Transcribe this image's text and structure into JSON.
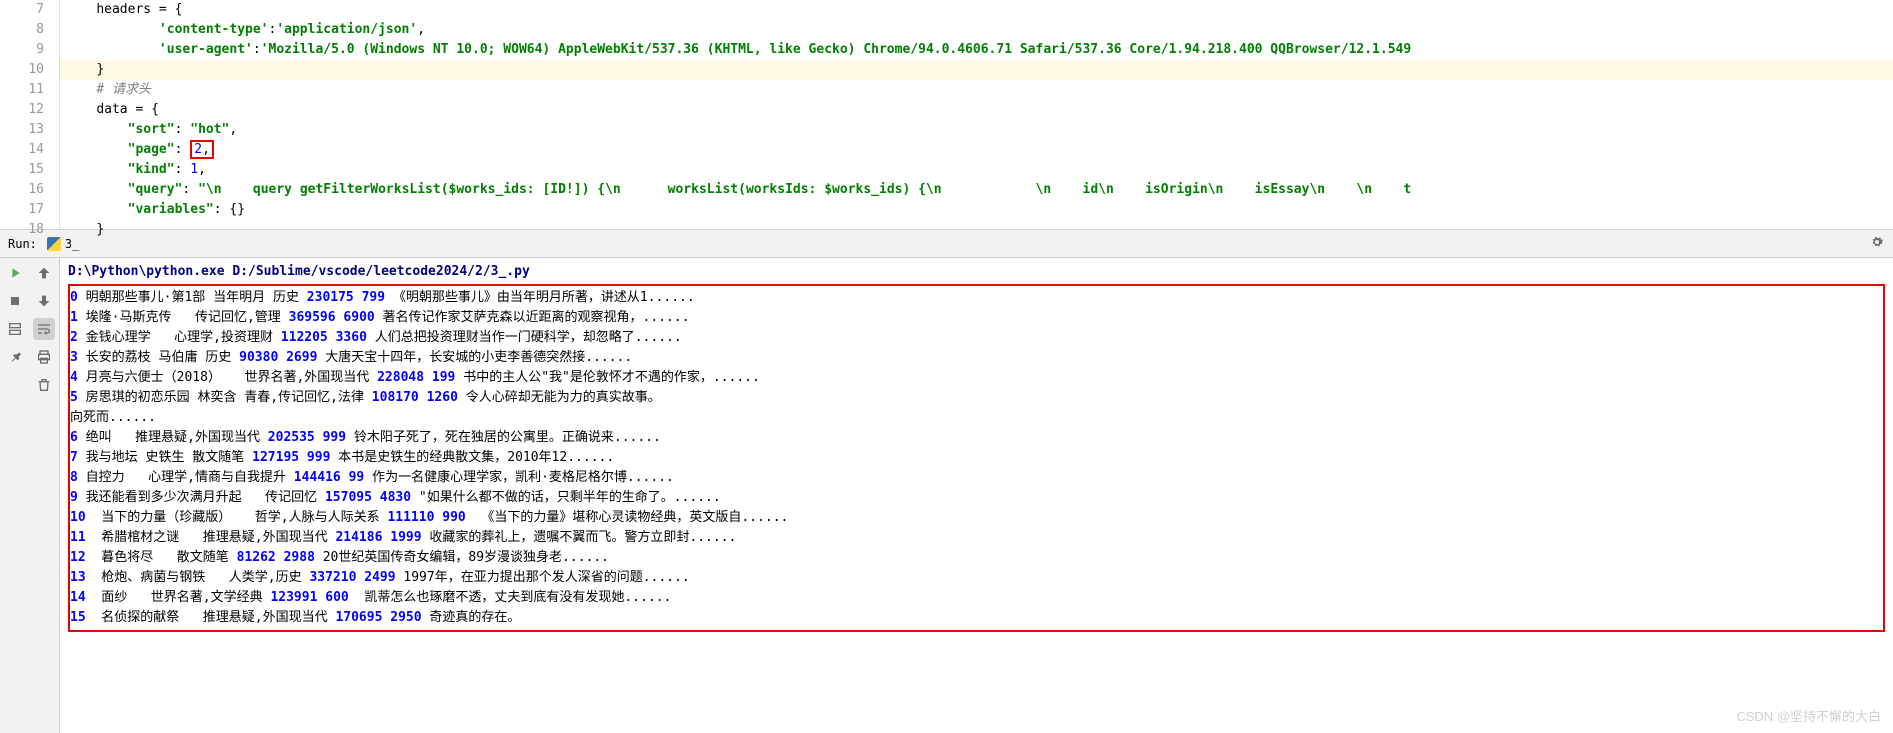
{
  "editor": {
    "lines": [
      7,
      8,
      9,
      10,
      11,
      12,
      13,
      14,
      15,
      16,
      17,
      18
    ],
    "l7_var": "headers",
    "l7_eq": " = ",
    "l7_brace": "{",
    "l8_key": "'content-type'",
    "l8_colon": ":",
    "l8_val": "'application/json'",
    "l8_comma": ",",
    "l9_key": "'user-agent'",
    "l9_colon": ":",
    "l9_val": "'Mozilla/5.0 (Windows NT 10.0; WOW64) AppleWebKit/537.36 (KHTML, like Gecko) Chrome/94.0.4606.71 Safari/537.36 Core/1.94.218.400 QQBrowser/12.1.549",
    "l10_brace": "}",
    "l11_comment": "# 请求头",
    "l12_var": "data",
    "l12_eq": " = {",
    "l13_key": "\"sort\"",
    "l13_colon": ": ",
    "l13_val": "\"hot\"",
    "l13_comma": ",",
    "l14_key": "\"page\"",
    "l14_colon": ": ",
    "l14_val": "2",
    "l14_comma": ",",
    "l15_key": "\"kind\"",
    "l15_colon": ": ",
    "l15_val": "1",
    "l15_comma": ",",
    "l16_key": "\"query\"",
    "l16_colon": ": ",
    "l16_val": "\"\\n    query getFilterWorksList($works_ids: [ID!]) {\\n      worksList(worksIds: $works_ids) {\\n            \\n    id\\n    isOrigin\\n    isEssay\\n    \\n    t",
    "l17_key": "\"variables\"",
    "l17_colon": ": {}",
    "l18_brace": "}"
  },
  "run": {
    "label": "Run:",
    "script": "3_"
  },
  "console": {
    "cmd_exe": "D:\\Python\\python.exe",
    "cmd_arg": " D:/Sublime/vscode/leetcode2024/2/3_.py",
    "rows": [
      {
        "idx": "0",
        "title": " 明朝那些事儿·第1部 当年明月 历史 ",
        "n1": "230175",
        "n2": " 799",
        "tail": " 《明朝那些事儿》由当年明月所著，讲述从1......"
      },
      {
        "idx": "1",
        "title": " 埃隆·马斯克传   传记回忆,管理 ",
        "n1": "369596",
        "n2": " 6900",
        "tail": " 著名传记作家艾萨克森以近距离的观察视角，......"
      },
      {
        "idx": "2",
        "title": " 金钱心理学   心理学,投资理财 ",
        "n1": "112205",
        "n2": " 3360",
        "tail": " 人们总把投资理财当作一门硬科学，却忽略了......"
      },
      {
        "idx": "3",
        "title": " 长安的荔枝 马伯庸 历史 ",
        "n1": "90380",
        "n2": " 2699",
        "tail": " 大唐天宝十四年，长安城的小吏李善德突然接......"
      },
      {
        "idx": "4",
        "title": " 月亮与六便士（2018）   世界名著,外国现当代 ",
        "n1": "228048",
        "n2": " 199",
        "tail": " 书中的主人公\"我\"是伦敦怀才不遇的作家，......"
      },
      {
        "idx": "5",
        "title": " 房思琪的初恋乐园 林奕含 青春,传记回忆,法律 ",
        "n1": "108170",
        "n2": " 1260",
        "tail": " 令人心碎却无能为力的真实故事。"
      },
      {
        "idx": "",
        "title": "向死而......",
        "n1": "",
        "n2": "",
        "tail": ""
      },
      {
        "idx": "6",
        "title": " 绝叫   推理悬疑,外国现当代 ",
        "n1": "202535",
        "n2": " 999",
        "tail": " 铃木阳子死了，死在独居的公寓里。正确说来......"
      },
      {
        "idx": "7",
        "title": " 我与地坛 史铁生 散文随笔 ",
        "n1": "127195",
        "n2": " 999",
        "tail": " 本书是史铁生的经典散文集，2010年12......"
      },
      {
        "idx": "8",
        "title": " 自控力   心理学,情商与自我提升 ",
        "n1": "144416",
        "n2": " 99",
        "tail": " 作为一名健康心理学家，凯利·麦格尼格尔博......"
      },
      {
        "idx": "9",
        "title": " 我还能看到多少次满月升起   传记回忆 ",
        "n1": "157095",
        "n2": " 4830",
        "tail": " \"如果什么都不做的话，只剩半年的生命了。......"
      },
      {
        "idx": "10",
        "title": "  当下的力量（珍藏版）   哲学,人脉与人际关系 ",
        "n1": "111110",
        "n2": " 990",
        "tail": "  《当下的力量》堪称心灵读物经典，英文版自......"
      },
      {
        "idx": "11",
        "title": "  希腊棺材之谜   推理悬疑,外国现当代 ",
        "n1": "214186",
        "n2": " 1999",
        "tail": " 收藏家的葬礼上，遗嘱不翼而飞。警方立即封......"
      },
      {
        "idx": "12",
        "title": "  暮色将尽   散文随笔 ",
        "n1": "81262",
        "n2": " 2988",
        "tail": " 20世纪英国传奇女编辑，89岁漫谈独身老......"
      },
      {
        "idx": "13",
        "title": "  枪炮、病菌与钢铁   人类学,历史 ",
        "n1": "337210",
        "n2": " 2499",
        "tail": " 1997年，在亚力提出那个发人深省的问题......"
      },
      {
        "idx": "14",
        "title": "  面纱   世界名著,文学经典 ",
        "n1": "123991",
        "n2": " 600",
        "tail": "  凯蒂怎么也琢磨不透，丈夫到底有没有发现她......"
      },
      {
        "idx": "15",
        "title": "  名侦探的献祭   推理悬疑,外国现当代 ",
        "n1": "170695",
        "n2": " 2950",
        "tail": " 奇迹真的存在。"
      }
    ]
  },
  "watermark": "CSDN @坚持不懈的大白"
}
